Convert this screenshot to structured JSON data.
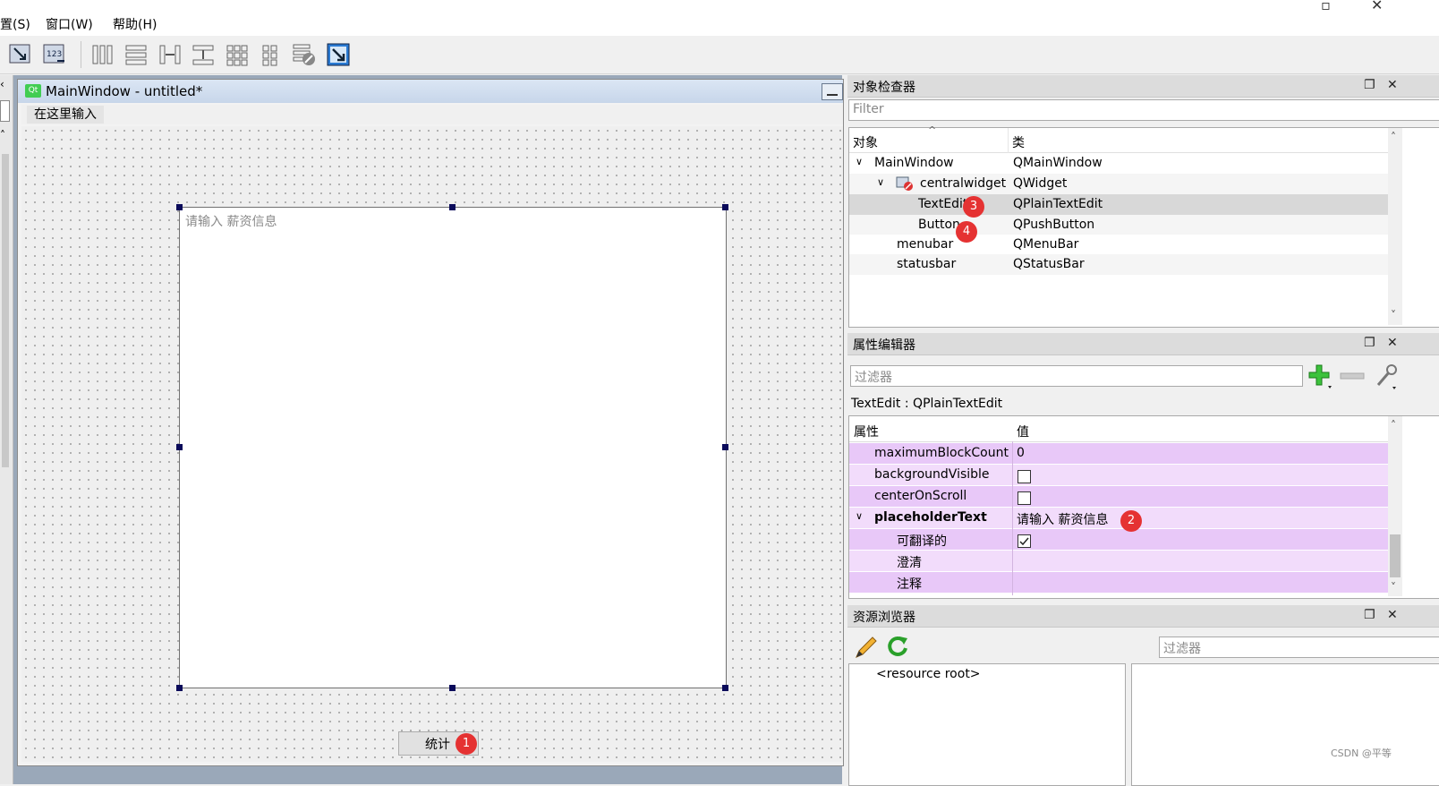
{
  "menubar": {
    "items": [
      "置(S)",
      "窗口(W)",
      "帮助(H)"
    ]
  },
  "form_window": {
    "title": "MainWindow - untitled*",
    "menubar_placeholder": "在这里输入",
    "textedit_placeholder": "请输入 薪资信息",
    "button_label": "统计"
  },
  "badges": [
    "1",
    "2",
    "3",
    "4"
  ],
  "object_inspector": {
    "title": "对象检查器",
    "filter_placeholder": "Filter",
    "columns": [
      "对象",
      "类"
    ],
    "rows": [
      {
        "name": "MainWindow",
        "class": "QMainWindow"
      },
      {
        "name": "centralwidget",
        "class": "QWidget"
      },
      {
        "name": "TextEdit",
        "class": "QPlainTextEdit"
      },
      {
        "name": "Button",
        "class": "QPushButton"
      },
      {
        "name": "menubar",
        "class": "QMenuBar"
      },
      {
        "name": "statusbar",
        "class": "QStatusBar"
      }
    ]
  },
  "property_editor": {
    "title": "属性编辑器",
    "filter_placeholder": "过滤器",
    "object_label": "TextEdit : QPlainTextEdit",
    "columns": [
      "属性",
      "值"
    ],
    "rows": [
      {
        "name": "maximumBlockCount",
        "value": "0"
      },
      {
        "name": "backgroundVisible",
        "value": ""
      },
      {
        "name": "centerOnScroll",
        "value": ""
      },
      {
        "name": "placeholderText",
        "value": "请输入 薪资信息"
      },
      {
        "name": "可翻译的",
        "value": ""
      },
      {
        "name": "澄清",
        "value": ""
      },
      {
        "name": "注释",
        "value": ""
      }
    ],
    "checkboxes": {
      "backgroundVisible": false,
      "centerOnScroll": false,
      "translatable": true
    }
  },
  "resource_browser": {
    "title": "资源浏览器",
    "filter_placeholder": "过滤器",
    "root_label": "<resource root>"
  },
  "watermark": "CSDN @平等",
  "colors": {
    "property_row": "#e8c8f8",
    "property_row_alt": "#f2dcfb",
    "badge": "#e53232",
    "selection": "#d8d8d8"
  }
}
